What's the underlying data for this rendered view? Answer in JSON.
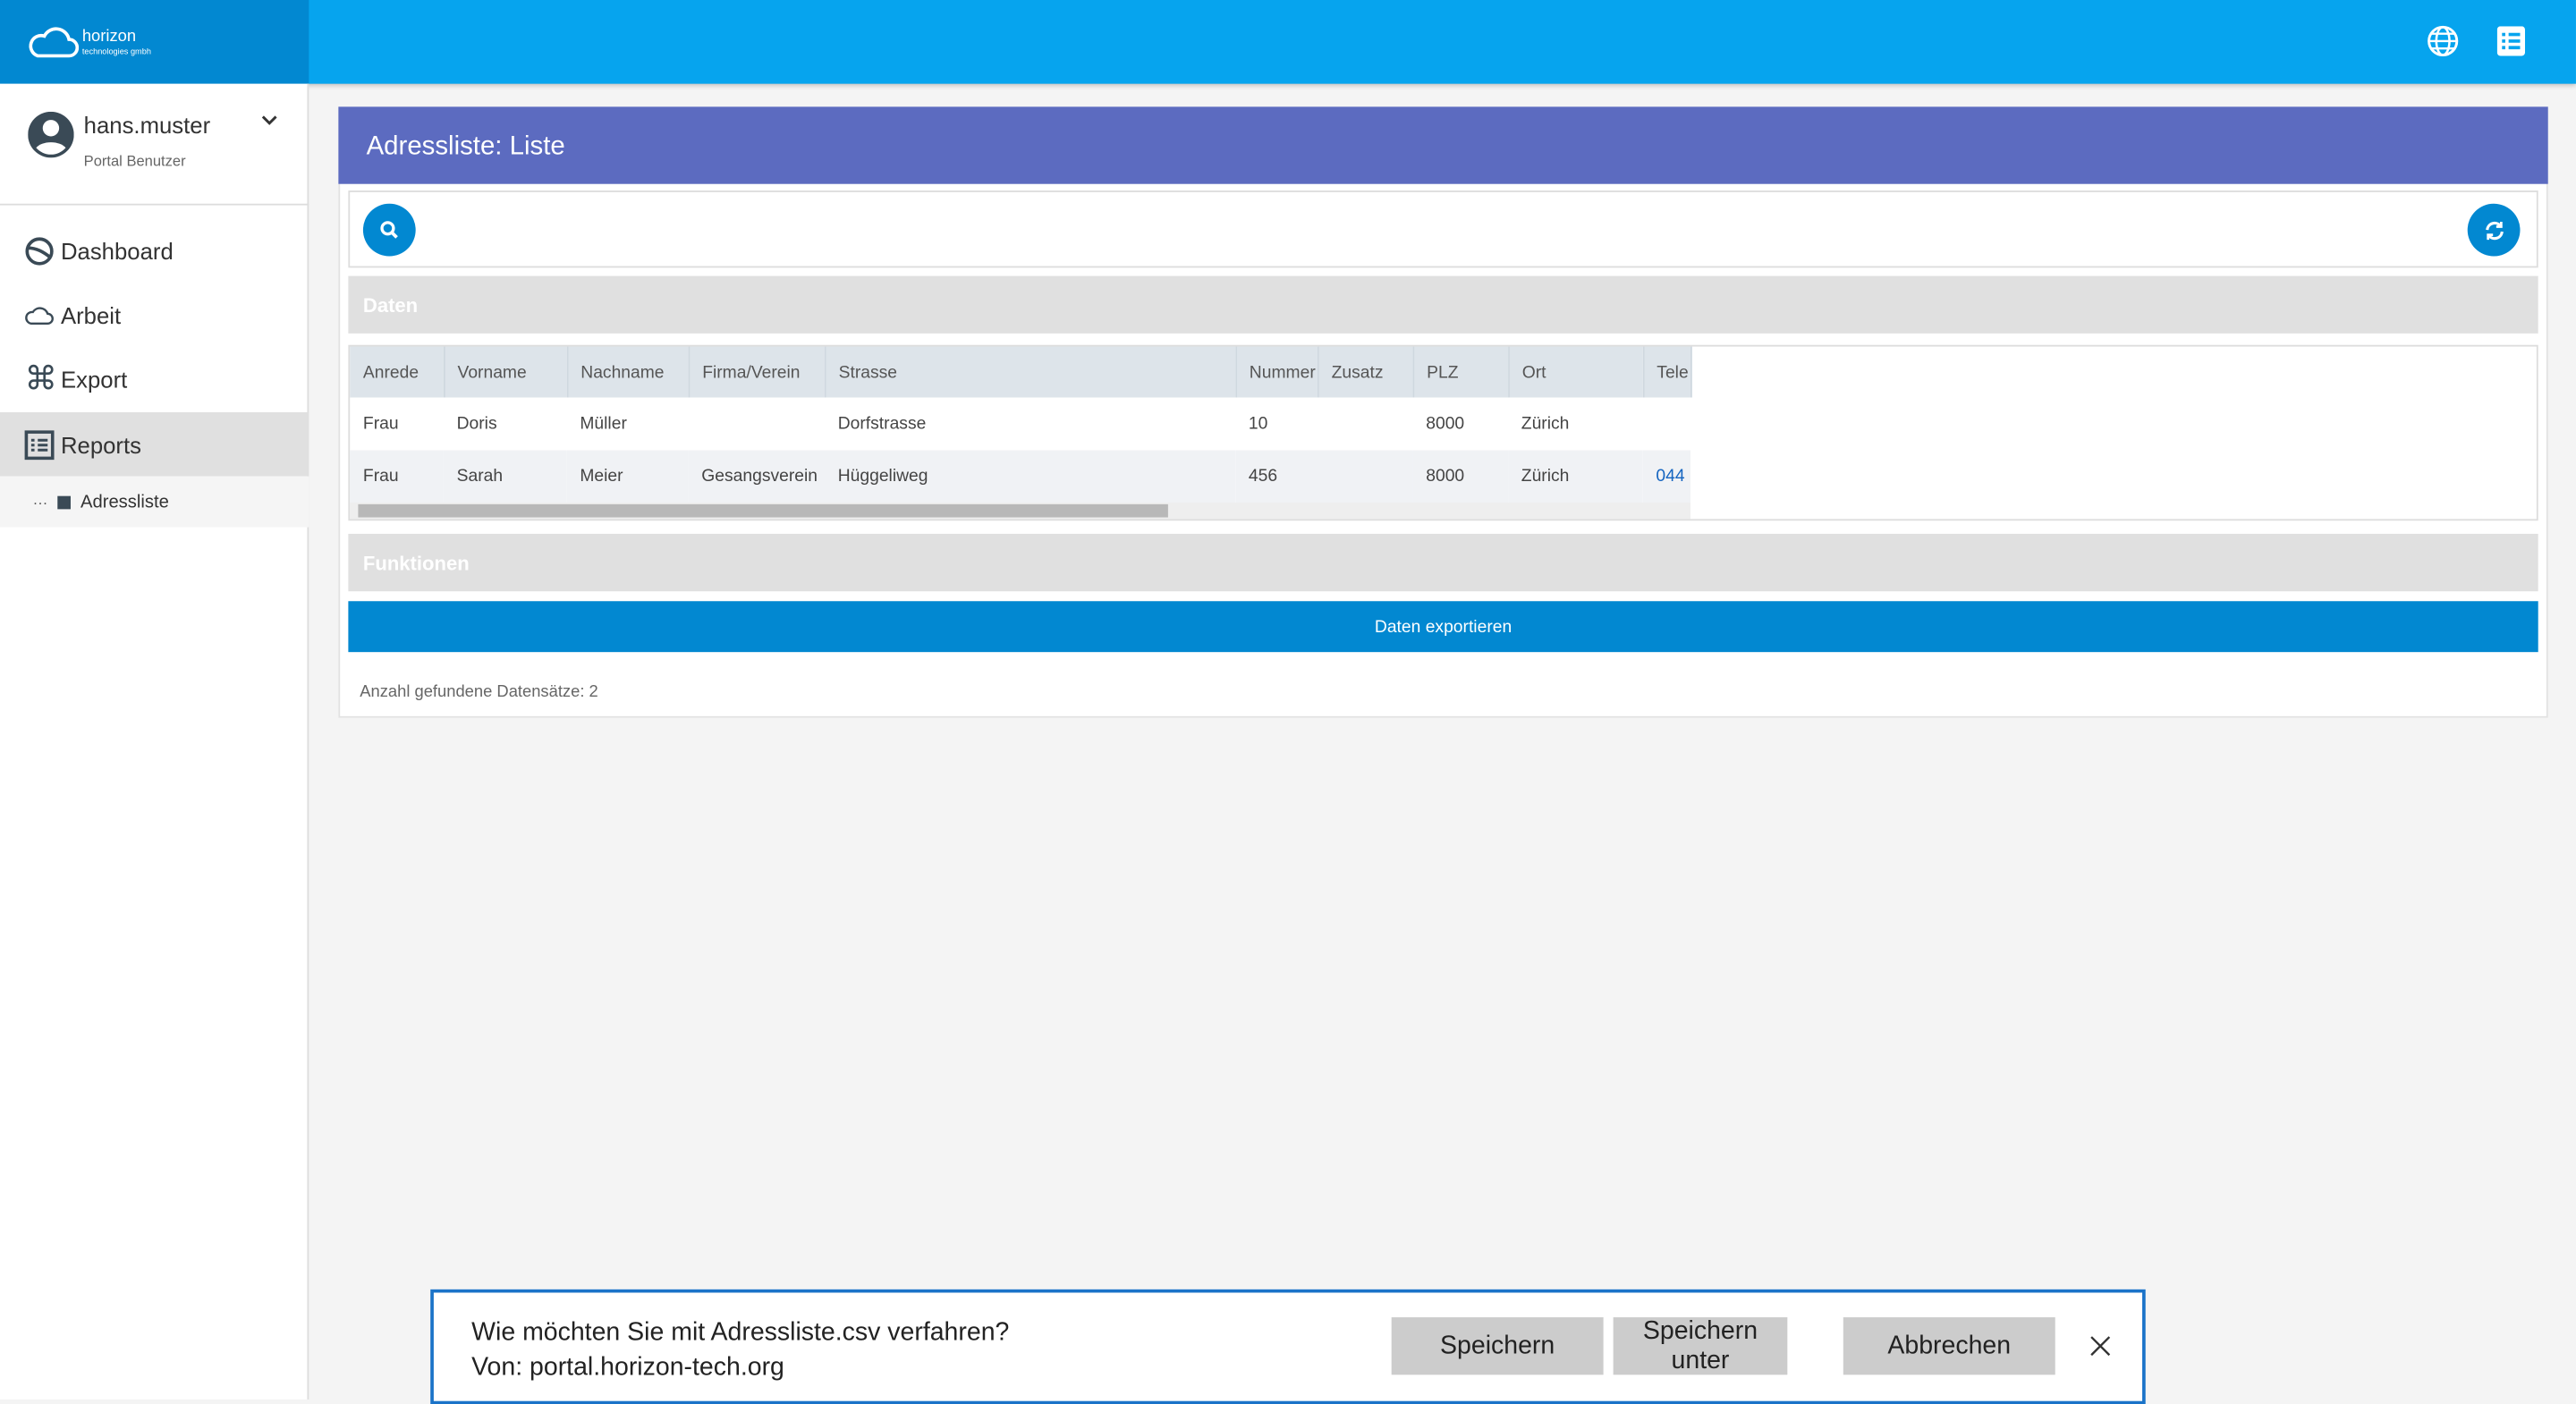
{
  "header": {
    "logo": {
      "name": "horizon",
      "tagline": "technologies gmbh"
    },
    "icons": [
      "globe-icon",
      "list-icon"
    ],
    "colors": {
      "bar": "#06a4ee",
      "logo_bg": "#0288d1"
    }
  },
  "user": {
    "name": "hans.muster",
    "role": "Portal Benutzer"
  },
  "sidebar": {
    "items": [
      {
        "label": "Dashboard",
        "icon": "dashboard-icon"
      },
      {
        "label": "Arbeit",
        "icon": "cloud-icon"
      },
      {
        "label": "Export",
        "icon": "command-icon"
      },
      {
        "label": "Reports",
        "icon": "report-icon",
        "active": true
      }
    ],
    "sub_items": [
      {
        "label": "Adressliste"
      }
    ]
  },
  "page": {
    "title": "Adressliste: Liste",
    "section_data": "Daten",
    "section_functions": "Funktionen",
    "export_label": "Daten exportieren",
    "count_text": "Anzahl gefundene Datensätze: 2"
  },
  "table": {
    "columns": [
      "Anrede",
      "Vorname",
      "Nachname",
      "Firma/Verein",
      "Strasse",
      "Nummer",
      "Zusatz",
      "PLZ",
      "Ort",
      "Tele"
    ],
    "rows": [
      [
        "Frau",
        "Doris",
        "Müller",
        "",
        "Dorfstrasse",
        "10",
        "",
        "8000",
        "Zürich",
        ""
      ],
      [
        "Frau",
        "Sarah",
        "Meier",
        "Gesangsverein",
        "Hüggeliweg",
        "456",
        "",
        "8000",
        "Zürich",
        "044"
      ]
    ]
  },
  "dialog": {
    "question": "Wie möchten Sie mit Adressliste.csv verfahren?",
    "source": "Von: portal.horizon-tech.org",
    "save": "Speichern",
    "save_as": "Speichern unter",
    "cancel": "Abbrechen"
  }
}
